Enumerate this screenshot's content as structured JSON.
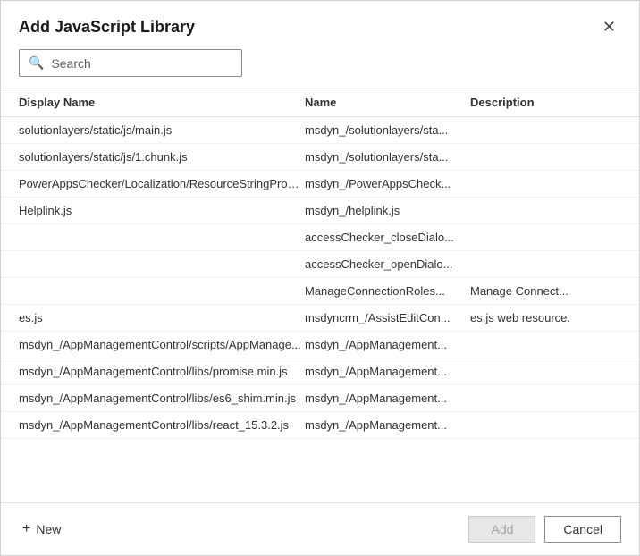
{
  "dialog": {
    "title": "Add JavaScript Library",
    "close_label": "✕"
  },
  "search": {
    "placeholder": "Search",
    "value": ""
  },
  "table": {
    "columns": {
      "display_name": "Display Name",
      "name": "Name",
      "description": "Description"
    },
    "rows": [
      {
        "display_name": "solutionlayers/static/js/main.js",
        "name": "msdyn_/solutionlayers/sta...",
        "description": ""
      },
      {
        "display_name": "solutionlayers/static/js/1.chunk.js",
        "name": "msdyn_/solutionlayers/sta...",
        "description": ""
      },
      {
        "display_name": "PowerAppsChecker/Localization/ResourceStringProvid...",
        "name": "msdyn_/PowerAppsCheck...",
        "description": ""
      },
      {
        "display_name": "Helplink.js",
        "name": "msdyn_/helplink.js",
        "description": ""
      },
      {
        "display_name": "",
        "name": "accessChecker_closeDialo...",
        "description": ""
      },
      {
        "display_name": "",
        "name": "accessChecker_openDialo...",
        "description": ""
      },
      {
        "display_name": "",
        "name": "ManageConnectionRoles...",
        "description": "Manage Connect..."
      },
      {
        "display_name": "es.js",
        "name": "msdyncrm_/AssistEditCon...",
        "description": "es.js web resource."
      },
      {
        "display_name": "msdyn_/AppManagementControl/scripts/AppManage...",
        "name": "msdyn_/AppManagement...",
        "description": ""
      },
      {
        "display_name": "msdyn_/AppManagementControl/libs/promise.min.js",
        "name": "msdyn_/AppManagement...",
        "description": ""
      },
      {
        "display_name": "msdyn_/AppManagementControl/libs/es6_shim.min.js",
        "name": "msdyn_/AppManagement...",
        "description": ""
      },
      {
        "display_name": "msdyn_/AppManagementControl/libs/react_15.3.2.js",
        "name": "msdyn_/AppManagement...",
        "description": ""
      }
    ]
  },
  "footer": {
    "new_label": "New",
    "add_label": "Add",
    "cancel_label": "Cancel"
  }
}
